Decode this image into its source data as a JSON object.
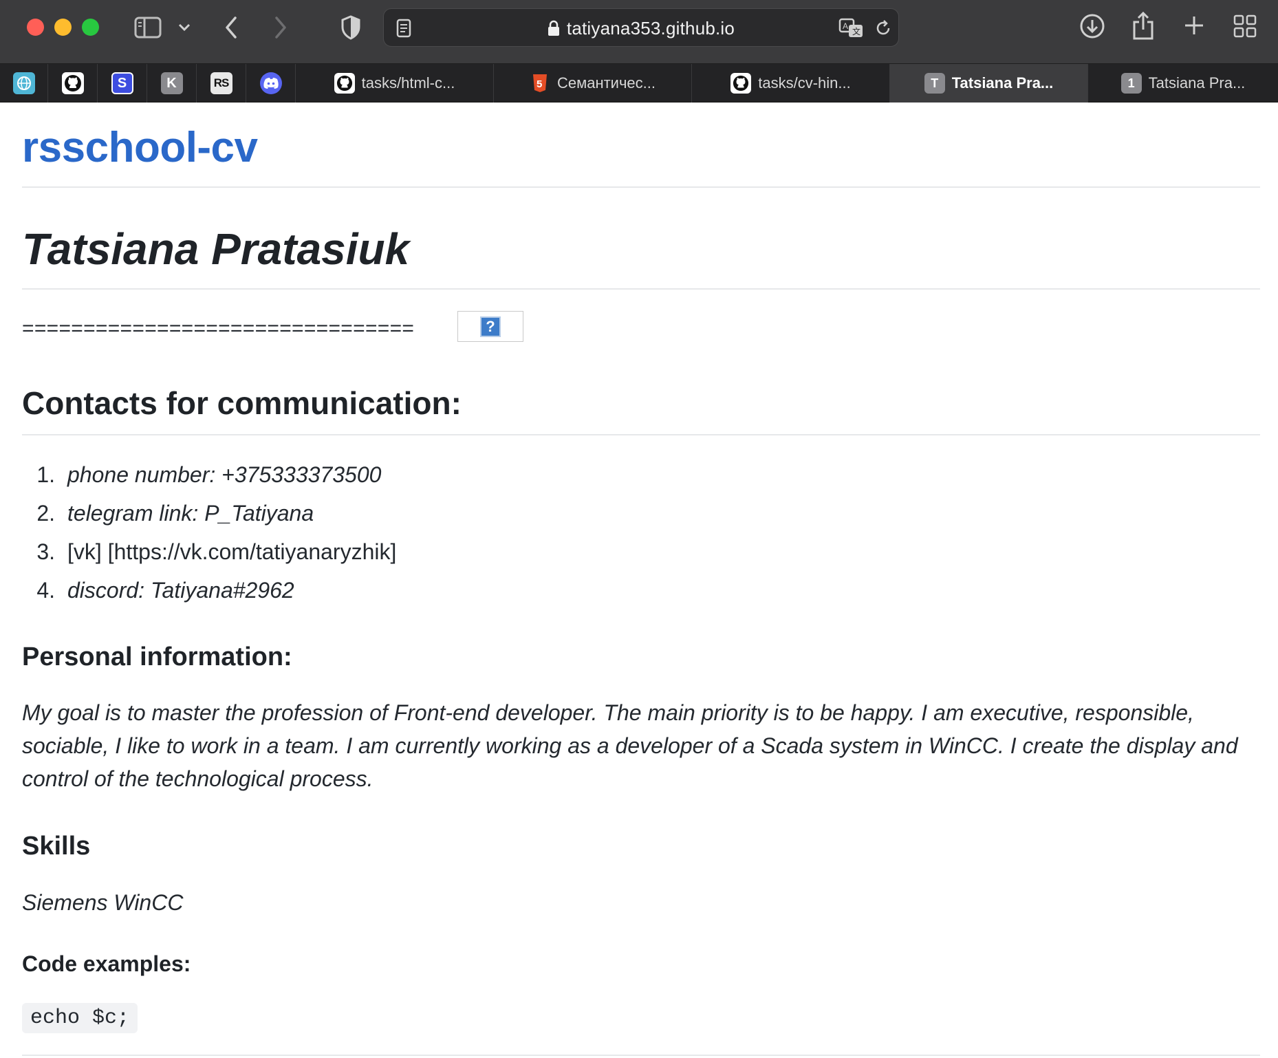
{
  "browser": {
    "url": "tatiyana353.github.io",
    "pinned_tabs": [
      {
        "name": "pinned-tab-1",
        "icon": "globe-icon",
        "letter": "",
        "color": "#4fb6d6"
      },
      {
        "name": "pinned-tab-github",
        "icon": "github-icon",
        "letter": "",
        "color": "#ffffff"
      },
      {
        "name": "pinned-tab-s",
        "icon": "s-icon",
        "letter": "S",
        "color": "#3d4de0"
      },
      {
        "name": "pinned-tab-k",
        "icon": "k-icon",
        "letter": "K",
        "color": "#8a8a8e"
      },
      {
        "name": "pinned-tab-rs",
        "icon": "rs-icon",
        "letter": "RS",
        "color": "#e8e8e8"
      },
      {
        "name": "pinned-tab-discord",
        "icon": "discord-icon",
        "letter": "",
        "color": "#5865f2"
      }
    ],
    "tabs": [
      {
        "label": "tasks/html-c...",
        "icon": "github-icon",
        "letter": ""
      },
      {
        "label": "Семантичес...",
        "icon": "html5-icon",
        "letter": "5"
      },
      {
        "label": "tasks/cv-hin...",
        "icon": "github-icon",
        "letter": ""
      },
      {
        "label": "Tatsiana Pra...",
        "icon": "t-icon",
        "letter": "T",
        "active": true
      },
      {
        "label": "Tatsiana Pra...",
        "icon": "one-icon",
        "letter": "1"
      }
    ]
  },
  "page": {
    "site_title": "rsschool-cv",
    "name": "Tatsiana Pratasiuk",
    "equals_line": "================================",
    "broken_image_glyph": "?",
    "contacts_heading": "Contacts for communication:",
    "contacts": [
      {
        "num": "1.",
        "text": "phone number: +375333373500",
        "italic": true
      },
      {
        "num": "2.",
        "text": "telegram link: P_Tatiyana",
        "italic": true
      },
      {
        "num": "3.",
        "text": "[vk] [https://vk.com/tatiyanaryzhik]",
        "italic": false
      },
      {
        "num": "4.",
        "text": "discord: Tatiyana#2962",
        "italic": true
      }
    ],
    "personal_heading": "Personal information:",
    "personal_text": "My goal is to master the profession of Front-end developer. The main priority is to be happy. I am executive, responsible, sociable, I like to work in a team. I am currently working as a developer of a Scada system in WinCC. I create the display and control of the technological process.",
    "skills_heading": "Skills",
    "skills_text": "Siemens WinCC",
    "code_heading": "Code examples:",
    "code_text": "echo $c;"
  },
  "colors": {
    "link_blue": "#2a68c9",
    "toolbar": "#3b3b3d",
    "tabbar": "#232325"
  }
}
